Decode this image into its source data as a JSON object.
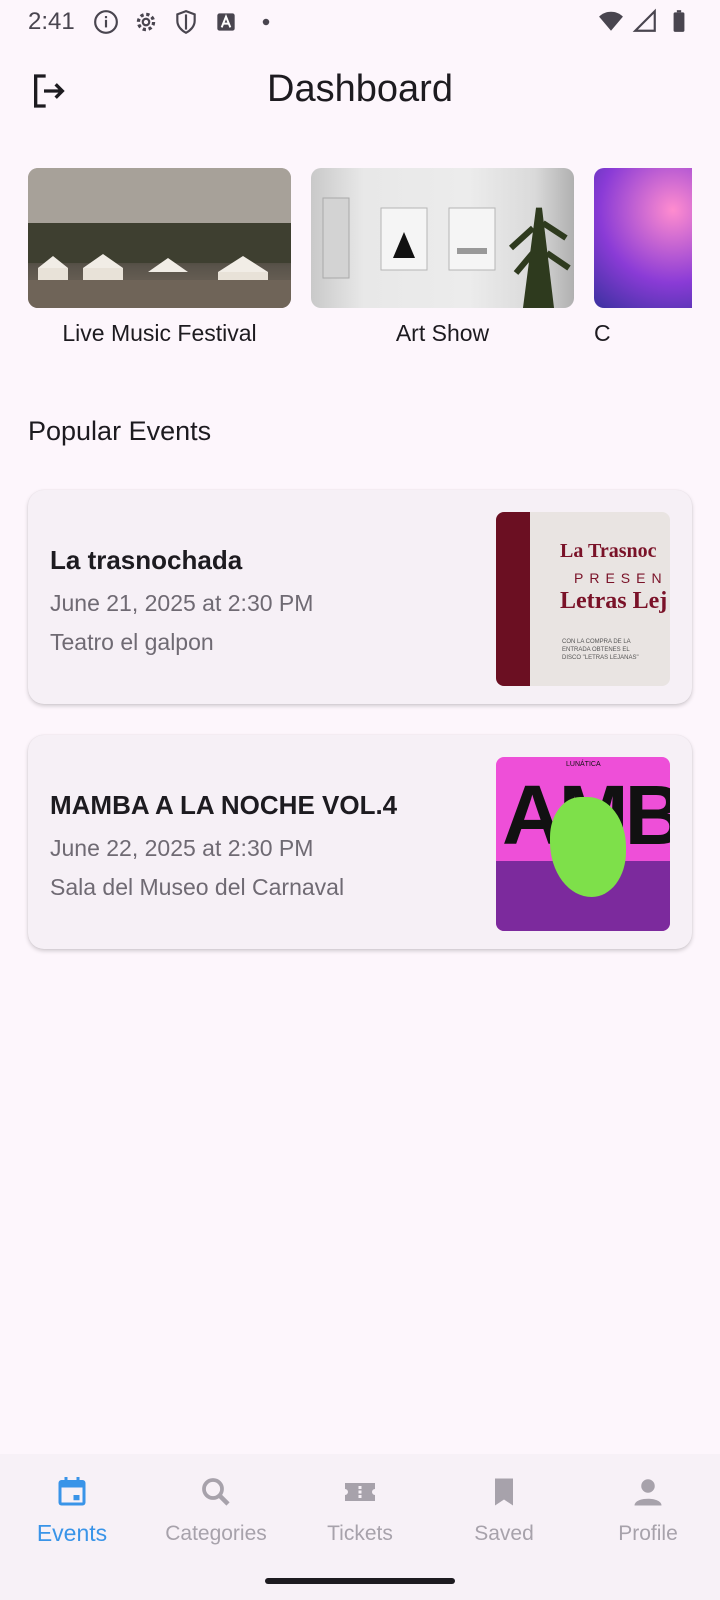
{
  "status_bar": {
    "time": "2:41",
    "icons": [
      "info-icon",
      "gear-icon",
      "shield-icon",
      "font-icon",
      "dot-icon",
      "wifi-icon",
      "signal-icon",
      "battery-icon"
    ]
  },
  "app_bar": {
    "title": "Dashboard",
    "logout_icon": "logout-icon"
  },
  "categories": [
    {
      "label": "Live Music Festival"
    },
    {
      "label": "Art Show"
    },
    {
      "label": "C"
    }
  ],
  "popular": {
    "title": "Popular Events",
    "events": [
      {
        "title": "La trasnochada",
        "date": "June 21, 2025 at 2:30 PM",
        "venue": "Teatro el galpon",
        "poster_lines": [
          "La Trasnoc",
          "PRESEN",
          "Letras Lej",
          "CON LA COMPRA DE LA ENTRADA OBTENES EL DISCO \"LETRAS LEJANAS\""
        ]
      },
      {
        "title": "MAMBA A LA NOCHE VOL.4",
        "date": "June 22, 2025 at 2:30 PM",
        "venue": "Sala del Museo del Carnaval",
        "poster_lines": [
          "LUNÁTICA",
          "AMB"
        ]
      }
    ]
  },
  "nav": {
    "items": [
      {
        "label": "Events",
        "icon": "calendar-icon",
        "active": true
      },
      {
        "label": "Categories",
        "icon": "search-icon",
        "active": false
      },
      {
        "label": "Tickets",
        "icon": "ticket-icon",
        "active": false
      },
      {
        "label": "Saved",
        "icon": "bookmark-icon",
        "active": false
      },
      {
        "label": "Profile",
        "icon": "person-icon",
        "active": false
      }
    ],
    "active_color": "#3994e8",
    "inactive_color": "#a7a2ab"
  },
  "colors": {
    "background": "#fdf6fc",
    "card": "#f6f0f6",
    "text": "#1d1b20",
    "muted": "#6f6a73"
  }
}
